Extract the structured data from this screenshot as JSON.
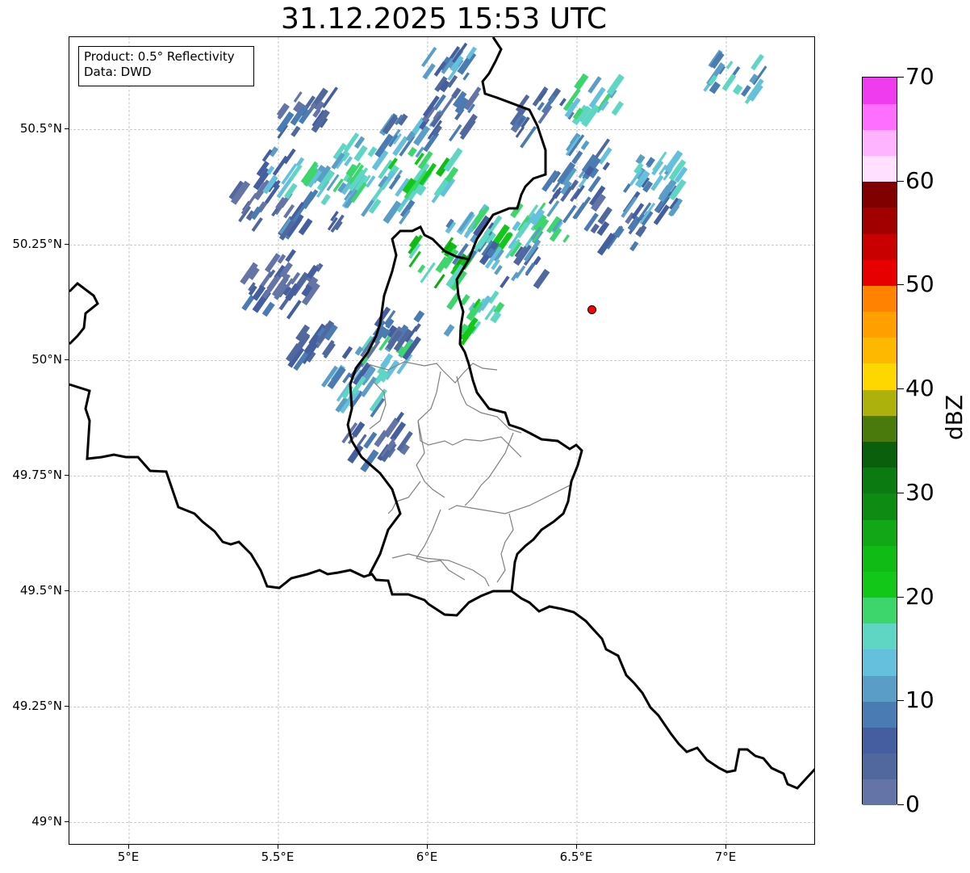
{
  "title": "31.12.2025 15:53 UTC",
  "info": {
    "product": "Product: 0.5° Reflectivity",
    "data": "Data: DWD"
  },
  "map": {
    "lon_range": [
      4.8,
      7.3
    ],
    "lat_range": [
      48.95,
      50.7
    ],
    "x_ticks": [
      {
        "lon": 5.0,
        "label": "5°E"
      },
      {
        "lon": 5.5,
        "label": "5.5°E"
      },
      {
        "lon": 6.0,
        "label": "6°E"
      },
      {
        "lon": 6.5,
        "label": "6.5°E"
      },
      {
        "lon": 7.0,
        "label": "7°E"
      }
    ],
    "y_ticks": [
      {
        "lat": 49.0,
        "label": "49°N"
      },
      {
        "lat": 49.25,
        "label": "49.25°N"
      },
      {
        "lat": 49.5,
        "label": "49.5°N"
      },
      {
        "lat": 49.75,
        "label": "49.75°N"
      },
      {
        "lat": 50.0,
        "label": "50°N"
      },
      {
        "lat": 50.25,
        "label": "50.25°N"
      },
      {
        "lat": 50.5,
        "label": "50.5°N"
      }
    ],
    "radar_site": {
      "lon": 6.55,
      "lat": 50.11,
      "color": "#ff0000"
    },
    "echo_cells": [
      {
        "lon": 5.45,
        "lat": 50.35,
        "dbz": 4
      },
      {
        "lon": 5.55,
        "lat": 50.42,
        "dbz": 12
      },
      {
        "lon": 5.62,
        "lat": 50.33,
        "dbz": 8
      },
      {
        "lon": 5.7,
        "lat": 50.4,
        "dbz": 16
      },
      {
        "lon": 5.8,
        "lat": 50.45,
        "dbz": 18
      },
      {
        "lon": 5.88,
        "lat": 50.37,
        "dbz": 14
      },
      {
        "lon": 5.95,
        "lat": 50.5,
        "dbz": 10
      },
      {
        "lon": 6.02,
        "lat": 50.42,
        "dbz": 20
      },
      {
        "lon": 6.08,
        "lat": 50.55,
        "dbz": 6
      },
      {
        "lon": 6.05,
        "lat": 50.23,
        "dbz": 22
      },
      {
        "lon": 6.15,
        "lat": 50.28,
        "dbz": 12
      },
      {
        "lon": 6.25,
        "lat": 50.3,
        "dbz": 18
      },
      {
        "lon": 6.3,
        "lat": 50.22,
        "dbz": 10
      },
      {
        "lon": 6.4,
        "lat": 50.3,
        "dbz": 16
      },
      {
        "lon": 6.5,
        "lat": 50.38,
        "dbz": 8
      },
      {
        "lon": 6.55,
        "lat": 50.45,
        "dbz": 10
      },
      {
        "lon": 6.65,
        "lat": 50.3,
        "dbz": 6
      },
      {
        "lon": 6.75,
        "lat": 50.38,
        "dbz": 12
      },
      {
        "lon": 6.8,
        "lat": 50.42,
        "dbz": 14
      },
      {
        "lon": 6.4,
        "lat": 50.55,
        "dbz": 6
      },
      {
        "lon": 6.55,
        "lat": 50.58,
        "dbz": 16
      },
      {
        "lon": 7.05,
        "lat": 50.64,
        "dbz": 14
      },
      {
        "lon": 6.15,
        "lat": 50.12,
        "dbz": 18
      },
      {
        "lon": 5.85,
        "lat": 50.02,
        "dbz": 16
      },
      {
        "lon": 5.78,
        "lat": 49.96,
        "dbz": 12
      },
      {
        "lon": 5.9,
        "lat": 50.08,
        "dbz": 6
      },
      {
        "lon": 5.5,
        "lat": 50.17,
        "dbz": 6
      },
      {
        "lon": 5.58,
        "lat": 50.2,
        "dbz": 4
      },
      {
        "lon": 5.65,
        "lat": 50.05,
        "dbz": 6
      },
      {
        "lon": 5.85,
        "lat": 49.85,
        "dbz": 4
      },
      {
        "lon": 6.1,
        "lat": 50.65,
        "dbz": 10
      },
      {
        "lon": 5.6,
        "lat": 50.55,
        "dbz": 6
      }
    ]
  },
  "colorbar": {
    "unit": "dBZ",
    "min": 0,
    "max": 70,
    "step": 2.5,
    "tick_labels": [
      "0",
      "10",
      "20",
      "30",
      "40",
      "50",
      "60",
      "70"
    ],
    "colors": [
      "#6474a6",
      "#51689f",
      "#445ea0",
      "#4a7bb2",
      "#5a9ec7",
      "#64c0dc",
      "#5fd6c4",
      "#3dd66c",
      "#12c717",
      "#10bb16",
      "#12a716",
      "#0d8b12",
      "#0b7a10",
      "#095f0b",
      "#4a7a0b",
      "#acb10b",
      "#ffd700",
      "#ffb800",
      "#ffa000",
      "#ff8200",
      "#e60000",
      "#c80000",
      "#a00000",
      "#800000",
      "#ffe0ff",
      "#ffb4ff",
      "#ff6eff",
      "#ee3cee"
    ]
  }
}
